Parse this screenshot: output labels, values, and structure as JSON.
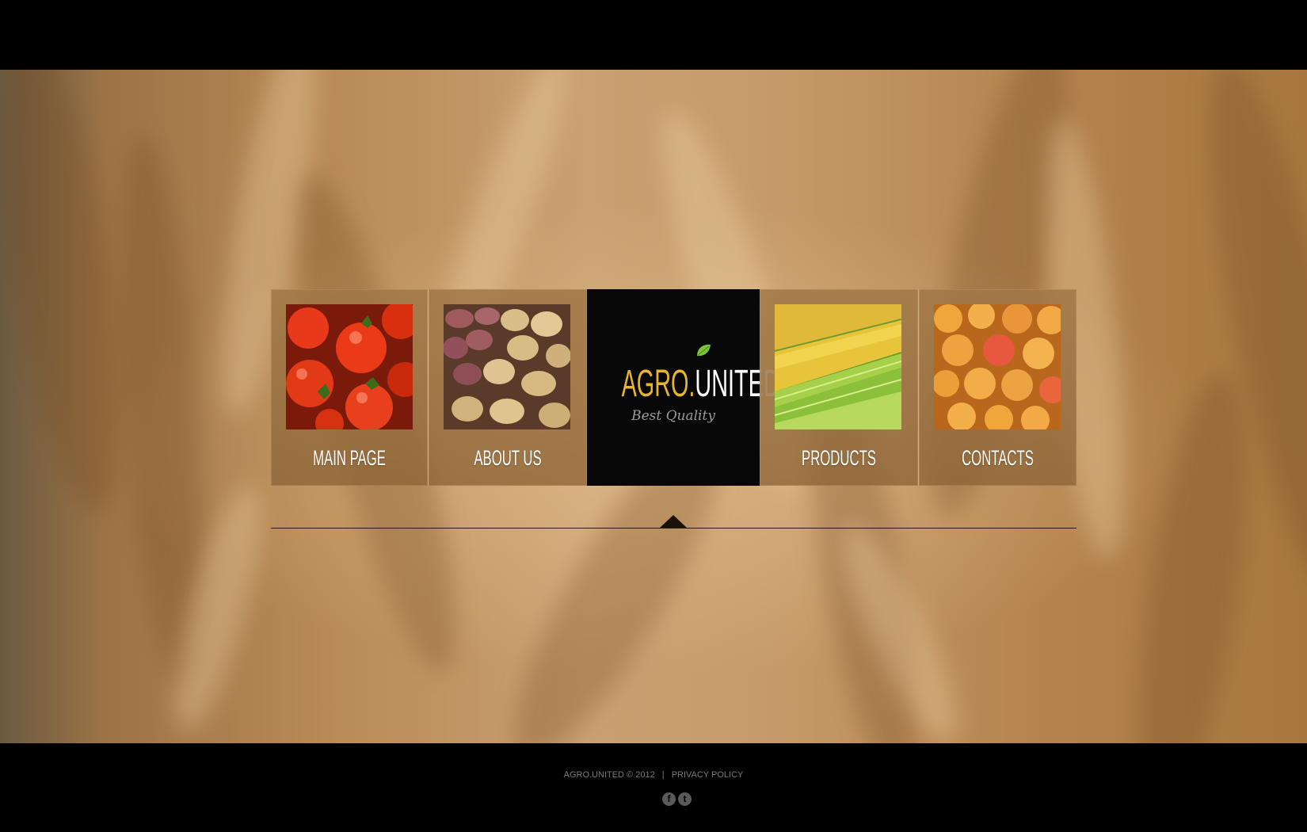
{
  "brand": {
    "name_part1": "AGRO.",
    "name_part2": "UNITED",
    "tagline": "Best Quality",
    "accent_color": "#e7b52c"
  },
  "nav": {
    "items": [
      {
        "label": "MAIN PAGE",
        "image": "tomatoes"
      },
      {
        "label": "ABOUT US",
        "image": "potatoes"
      },
      {
        "label": "PRODUCTS",
        "image": "corn"
      },
      {
        "label": "CONTACTS",
        "image": "apricots"
      }
    ],
    "active_index": 2
  },
  "footer": {
    "copyright": "AGRO.UNITED © 2012",
    "separator": "|",
    "privacy_link": "PRIVACY POLICY",
    "social": [
      {
        "name": "facebook-icon",
        "glyph": "f"
      },
      {
        "name": "twitter-icon",
        "glyph": "t"
      }
    ]
  }
}
